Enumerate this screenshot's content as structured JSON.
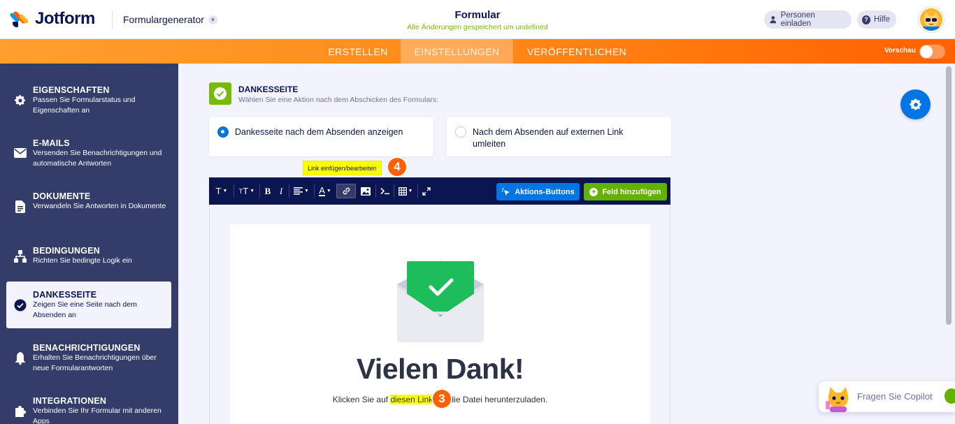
{
  "header": {
    "logo_text": "Jotform",
    "generator_label": "Formulargenerator",
    "form_title": "Formular",
    "save_status": "Alle Änderungen gespeichert um undefined",
    "invite_label": "Personen einladen",
    "help_label": "Hilfe"
  },
  "tabs": {
    "create": "ERSTELLEN",
    "settings": "EINSTELLUNGEN",
    "publish": "VERÖFFENTLICHEN",
    "preview_label": "Vorschau"
  },
  "sidebar": {
    "items": [
      {
        "title": "EIGENSCHAFTEN",
        "desc": "Passen Sie Formularstatus und Eigenschaften an"
      },
      {
        "title": "E-MAILS",
        "desc": "Versenden Sie Benachrichtigungen und automatische Antworten"
      },
      {
        "title": "DOKUMENTE",
        "desc": "Verwandeln Sie Antworten in Dokumente"
      },
      {
        "title": "BEDINGUNGEN",
        "desc": "Richten Sie bedingte Logik ein"
      },
      {
        "title": "DANKESSEITE",
        "desc": "Zeigen Sie eine Seite nach dem Absenden an"
      },
      {
        "title": "BENACHRICHTIGUNGEN",
        "desc": "Erhalten Sie Benachrichtigungen über neue Formularantworten"
      },
      {
        "title": "INTEGRATIONEN",
        "desc": "Verbinden Sie Ihr Formular mit anderen Apps"
      }
    ]
  },
  "section": {
    "title": "DANKESSEITE",
    "desc": "Wählen Sie eine Aktion nach dem Abschicken des Formulars:",
    "option_show": "Dankesseite nach dem Absenden anzeigen",
    "option_redirect": "Nach dem Absenden auf externen Link umleiten"
  },
  "tooltip": {
    "text": "Link einfügen/bearbeiten"
  },
  "badges": {
    "four": "4",
    "three": "3"
  },
  "toolbar": {
    "actions_label": "Aktions-Buttons",
    "add_field_label": "Feld hinzufügen"
  },
  "content": {
    "heading": "Vielen Dank!",
    "sub_before": "Klicken Sie auf ",
    "sub_link": "diesen Link",
    "sub_after": " um die Datei herunterzuladen."
  },
  "copilot": {
    "label": "Fragen Sie Copilot"
  },
  "colors": {
    "brand_orange": "#ff6100",
    "navy": "#0a1551",
    "sidebar": "#343c6a",
    "blue": "#0075e3",
    "green": "#64b200",
    "highlight": "#ffff00"
  }
}
